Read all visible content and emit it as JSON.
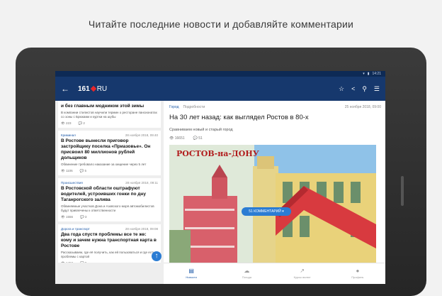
{
  "promo": {
    "headline": "Читайте последние новости и добавляйте комментарии"
  },
  "status_bar": {
    "time": "14:21"
  },
  "app_bar": {
    "logo_number": "161",
    "logo_suffix": "RU",
    "back_icon": "arrow-back-icon",
    "actions": [
      "star-icon",
      "share-icon",
      "search-icon",
      "menu-icon"
    ]
  },
  "feed": [
    {
      "category": "",
      "date": "",
      "title": "и без главным модником этой зимы",
      "desc": "В компании стилистов научили термин о ресторане пансионатах со зоны с Брюками и куртки на шубы",
      "views": "223",
      "comments": "2"
    },
    {
      "category": "Криминал",
      "date": "28 ноября 2018, 09:40",
      "title": "В Ростове вынесли приговор застройщику поселка «Приазовье». Он присвоил 80 миллионов рублей дольщиков",
      "desc": "Обвинение требовало наказание за хищение через 5 лет",
      "views": "1106",
      "comments": "5"
    },
    {
      "category": "Происшествия",
      "date": "28 ноября 2018, 09:11",
      "title": "В Ростовской области оштрафуют водителей, устроивших гонки по дну Таганрогского залива",
      "desc": "Обвиняемые участков Дона и Азовского моря автомобилистов будут привлечены к ответственности",
      "views": "1556",
      "comments": "3"
    },
    {
      "category": "Дорога и транспорт",
      "date": "28 ноября 2018, 09:08",
      "title": "Два года спустя проблемы все те же: кому и зачем нужна транспортная карта в Ростове",
      "desc": "Рассказываем, где её получить, как ей пользоваться и где есть проблемы с картой",
      "views": "1453",
      "comments": "9"
    }
  ],
  "article": {
    "category": "Город",
    "section": "Подробности",
    "date": "25 ноября 2018, 09:00",
    "title": "На 30 лет назад: как выглядел Ростов в 80-х",
    "subtitle": "Сравниваем новый и старый город",
    "views": "16651",
    "comments": "51",
    "image_caption": "РОСТОВ-на-ДОНУ",
    "comments_button": "51 КОММЕНТАРИЙ"
  },
  "bottom_nav": [
    {
      "label": "Новости",
      "icon": "news-icon",
      "active": true
    },
    {
      "label": "Погода",
      "icon": "weather-icon",
      "active": false
    },
    {
      "label": "Курсы валют",
      "icon": "chart-icon",
      "active": false
    },
    {
      "label": "Профиль",
      "icon": "profile-icon",
      "active": false
    }
  ],
  "colors": {
    "app_bar": "#16386d",
    "accent": "#2b7cd3",
    "logo_red": "#e8262a"
  }
}
